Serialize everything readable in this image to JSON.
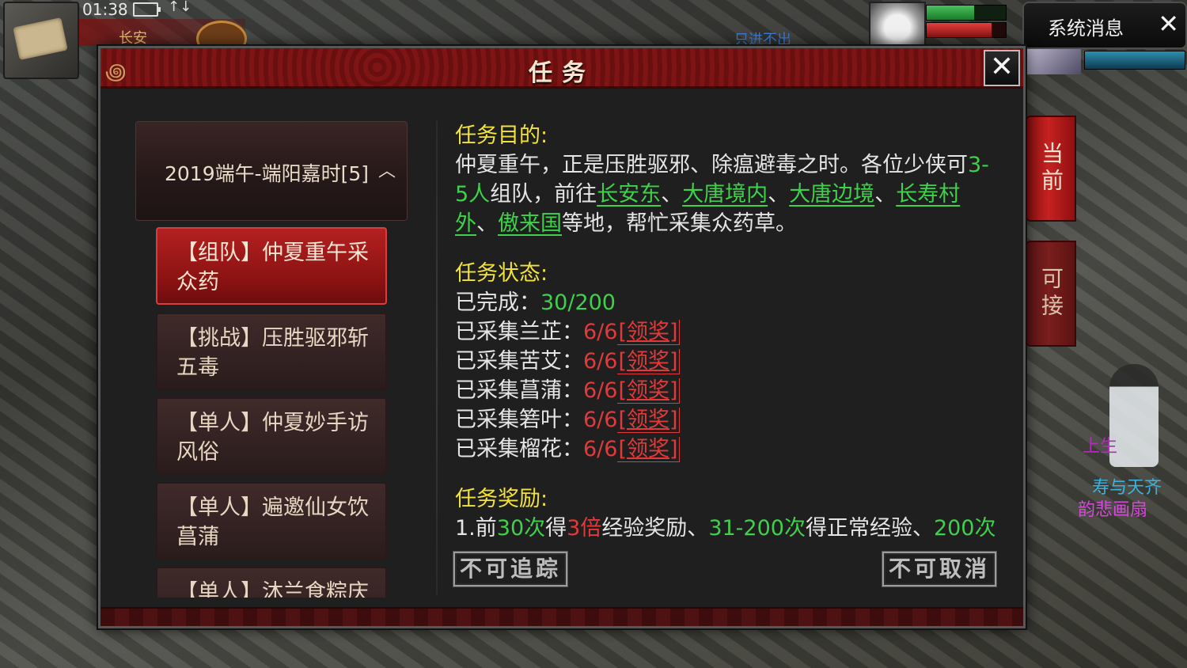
{
  "hud": {
    "clock": "01:38",
    "signal_icon": "↑↓",
    "location": "长安",
    "npc_text": "只进不出"
  },
  "system_message": {
    "label": "系统消息",
    "close": "✕"
  },
  "side_tabs": {
    "current": "当前",
    "available": "可接"
  },
  "scene": {
    "text1": "上生",
    "text2": "寿与天齐",
    "text3": "韵悲画扇"
  },
  "dialog": {
    "title": "任务",
    "close": "✕",
    "category": {
      "label": "2019端午-端阳嘉时[5]",
      "chevron": "︿"
    },
    "quests": [
      {
        "label": "【组队】仲夏重午采众药",
        "active": true
      },
      {
        "label": "【挑战】压胜驱邪斩五毒",
        "active": false
      },
      {
        "label": "【单人】仲夏妙手访风俗",
        "active": false
      },
      {
        "label": "【单人】遍邀仙女饮菖蒲",
        "active": false
      },
      {
        "label": "【单人】沐兰食粽庆",
        "active": false
      }
    ],
    "detail": {
      "objective_head": "任务目的:",
      "objective_p1": "仲夏重午，正是压胜驱邪、除瘟避毒之时。各位少侠可",
      "objective_num": "3-5人",
      "objective_p2": "组队，前往",
      "places": [
        "长安东",
        "大唐境内",
        "大唐边境",
        "长寿村外",
        "傲来国"
      ],
      "sep": "、",
      "objective_p3": "等地，帮忙采集众药草。",
      "status_head": "任务状态:",
      "completed_label": "已完成：",
      "completed_value": "30/200",
      "herbs": [
        {
          "label": "已采集兰芷：",
          "value": "6/6",
          "claim": "[领奖]"
        },
        {
          "label": "已采集苦艾：",
          "value": "6/6",
          "claim": "[领奖]"
        },
        {
          "label": "已采集菖蒲：",
          "value": "6/6",
          "claim": "[领奖]"
        },
        {
          "label": "已采集箬叶：",
          "value": "6/6",
          "claim": "[领奖]"
        },
        {
          "label": "已采集榴花：",
          "value": "6/6",
          "claim": "[领奖]"
        }
      ],
      "reward_head": "任务奖励:",
      "reward": {
        "a": "1.前",
        "b": "30次",
        "c": "得",
        "d": "3倍",
        "e": "经验奖励、",
        "f": "31-200次",
        "g": "得正常经验、",
        "h": "200次"
      }
    },
    "buttons": {
      "untrack": "不可追踪",
      "uncancel": "不可取消"
    }
  },
  "colors": {
    "accent_red": "#b42020",
    "section_yellow": "#f2e23c",
    "highlight_green": "#3fd14b",
    "alert_red": "#e23a3a"
  }
}
